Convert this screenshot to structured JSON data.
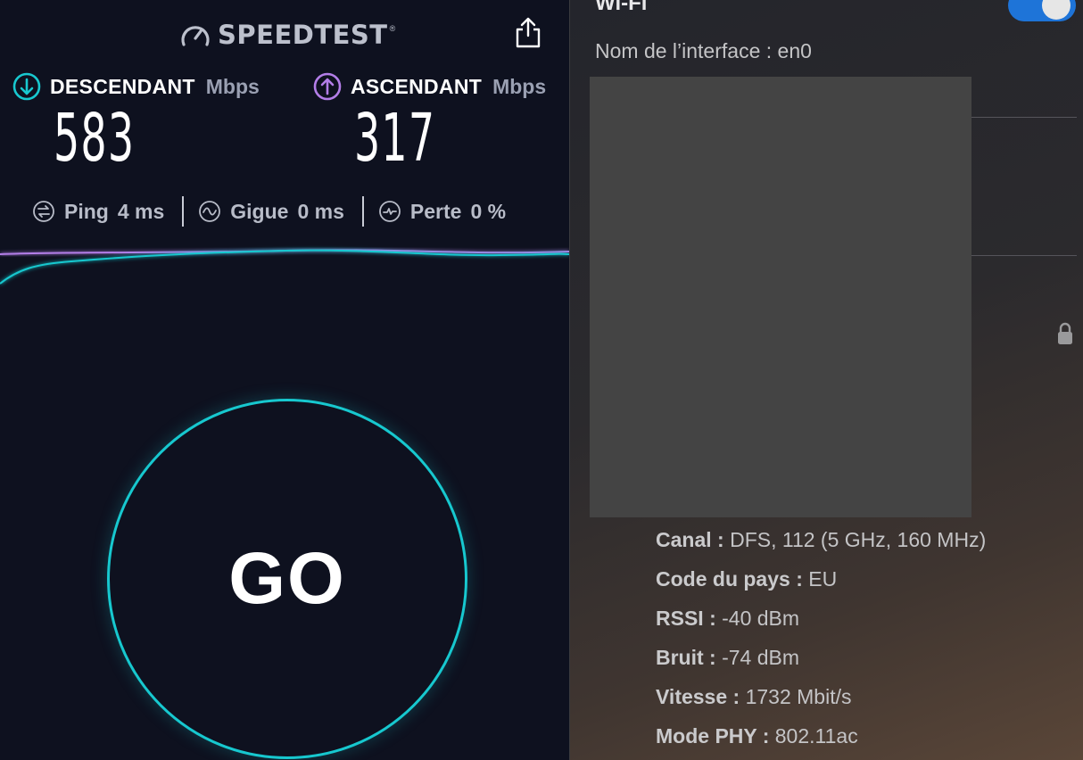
{
  "speedtest": {
    "logo_text": "SPEEDTEST",
    "logo_mark": "®",
    "download": {
      "label": "DESCENDANT",
      "unit": "Mbps",
      "value": "583",
      "color": "#18c8cf"
    },
    "upload": {
      "label": "ASCENDANT",
      "unit": "Mbps",
      "value": "317",
      "color": "#b37ee8"
    },
    "stats": [
      {
        "label": "Ping",
        "value": "4 ms"
      },
      {
        "label": "Gigue",
        "value": "0 ms"
      },
      {
        "label": "Perte",
        "value": "0 %"
      }
    ],
    "go_label": "GO",
    "accent": "#17c8cf"
  },
  "wifi": {
    "title": "Wi-Fi",
    "toggle_on": true,
    "toggle_color": "#1e74d8",
    "interface_label": "Nom de l’interface :",
    "interface_value": "en0",
    "details": [
      {
        "key": "Canal :",
        "value": "DFS, 112 (5 GHz, 160 MHz)"
      },
      {
        "key": "Code du pays :",
        "value": "EU"
      },
      {
        "key": "RSSI :",
        "value": "-40 dBm"
      },
      {
        "key": "Bruit :",
        "value": "-74 dBm"
      },
      {
        "key": "Vitesse :",
        "value": "1732 Mbit/s"
      },
      {
        "key": "Mode PHY :",
        "value": "802.11ac"
      }
    ]
  }
}
